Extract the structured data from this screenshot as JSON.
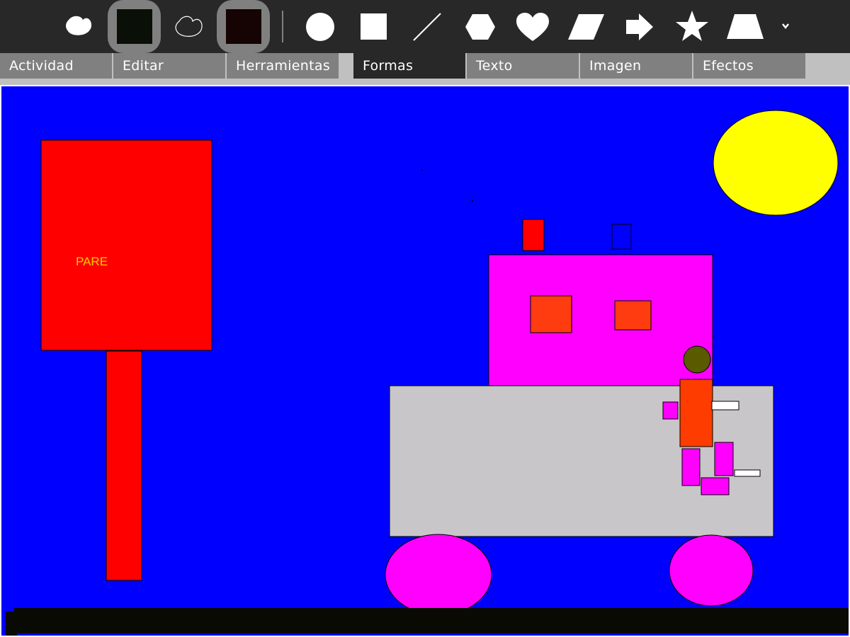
{
  "toolbar": {
    "tools": [
      {
        "name": "brush-shape-icon"
      },
      {
        "name": "stroke-color-swatch",
        "color": "#0a0f08"
      },
      {
        "name": "outline-shape-icon"
      },
      {
        "name": "fill-color-swatch",
        "color": "#160303"
      },
      {
        "name": "ellipse-icon"
      },
      {
        "name": "rectangle-icon"
      },
      {
        "name": "line-icon"
      },
      {
        "name": "hexagon-icon"
      },
      {
        "name": "heart-icon"
      },
      {
        "name": "parallelogram-icon"
      },
      {
        "name": "arrow-icon"
      },
      {
        "name": "star-icon"
      },
      {
        "name": "trapezoid-icon"
      },
      {
        "name": "chevron-down-icon"
      }
    ]
  },
  "tabs": [
    {
      "label": "Actividad"
    },
    {
      "label": "Editar"
    },
    {
      "label": "Herramientas"
    },
    {
      "label": "Formas",
      "selected": true
    },
    {
      "label": "Texto"
    },
    {
      "label": "Imagen"
    },
    {
      "label": "Efectos"
    }
  ],
  "canvas": {
    "background": "#0000ff",
    "sign_text": "PARE",
    "colors": {
      "sign": "#ff0000",
      "sign_text": "#ffcc00",
      "sun": "#ffff00",
      "cabin": "#ff00ff",
      "body": "#c8c6c9",
      "window": "#ff3c10",
      "wheel": "#ff00ff",
      "ground": "#0a0a05",
      "head": "#5a5a00",
      "person": "#ff3c00",
      "limb": "#ff00ff",
      "white": "#ffffff",
      "chimney_red": "#ff0000",
      "chimney_blue": "#0000ff"
    }
  }
}
